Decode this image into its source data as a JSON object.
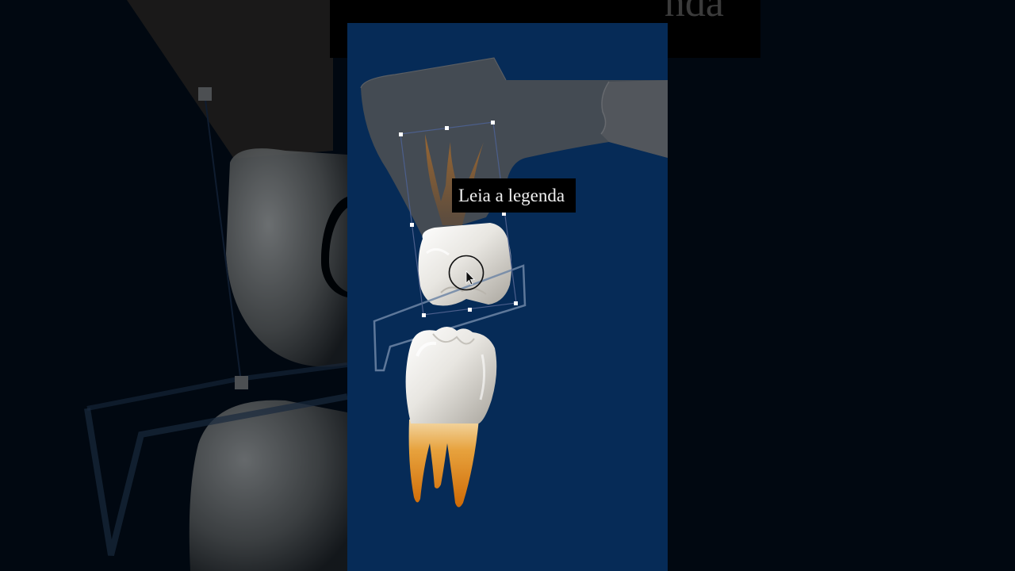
{
  "video": {
    "caption_text": "Leia a legenda",
    "top_caption_fragment": "nda"
  },
  "colors": {
    "panel_background": "#062b57",
    "outer_background": "#020a14",
    "enamel": "#f2f2ef",
    "root": "#e8890c",
    "overlay": "#4b4f55"
  },
  "icons": {
    "cursor": "pointer-arrow-icon",
    "selection_handles": "transform-handle-icon"
  }
}
